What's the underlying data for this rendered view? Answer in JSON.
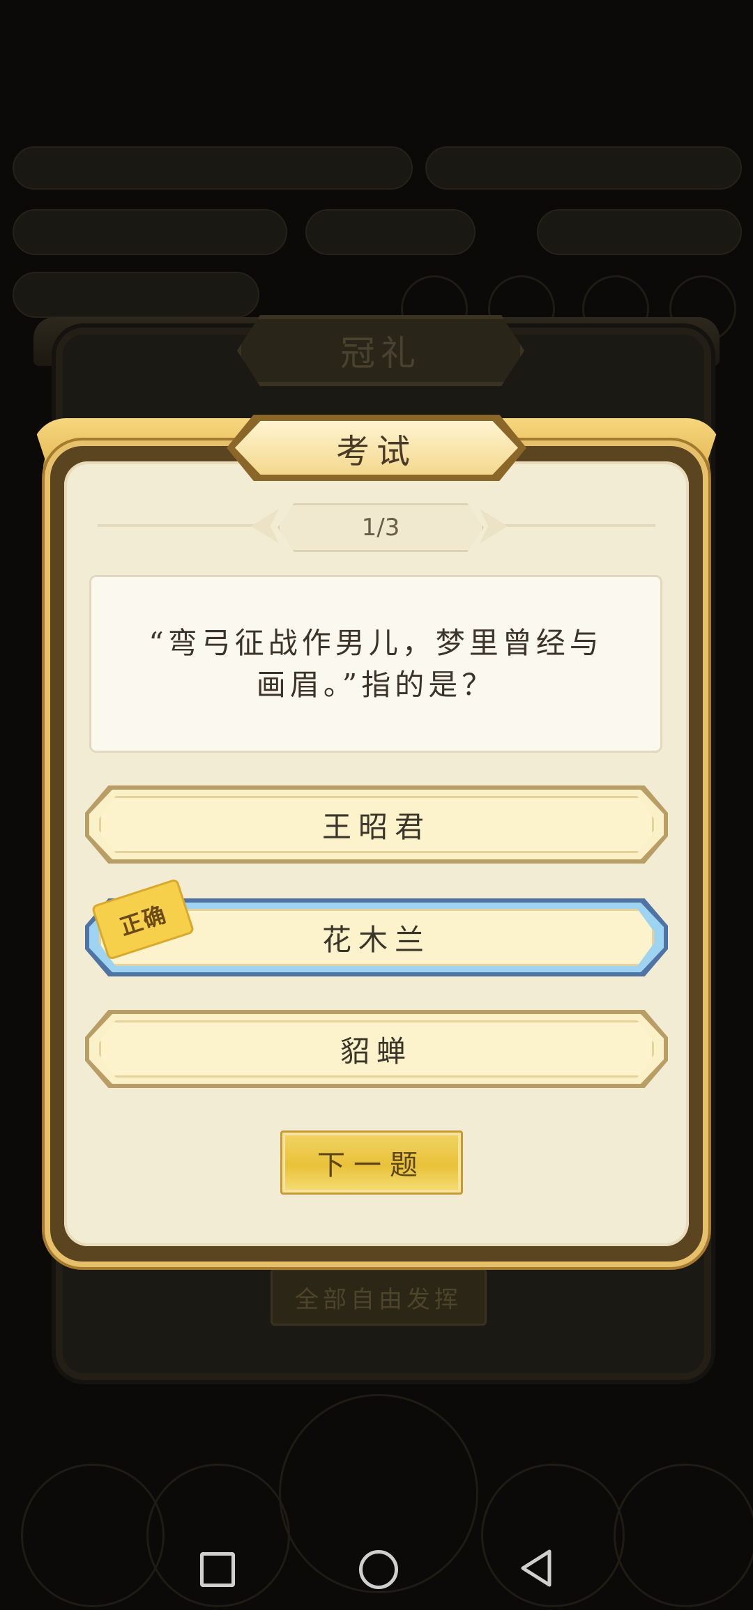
{
  "background": {
    "frame_title": "冠礼",
    "free_button": "全部自由发挥"
  },
  "dialog": {
    "title": "考试",
    "progress": "1/3",
    "question": "“弯弓征战作男儿，梦里曾经与画眉。”指的是？",
    "options": [
      {
        "label": "王昭君",
        "state": "normal"
      },
      {
        "label": "花木兰",
        "state": "correct"
      },
      {
        "label": "貂蝉",
        "state": "normal"
      }
    ],
    "correct_badge": "正确",
    "next_button": "下一题"
  },
  "colors": {
    "gold": "#e9c23a",
    "correct_border": "#9fd3f2",
    "panel": "#f3ecd5"
  },
  "navbar": {
    "icons": [
      "recent-apps-icon",
      "home-icon",
      "back-icon"
    ]
  }
}
